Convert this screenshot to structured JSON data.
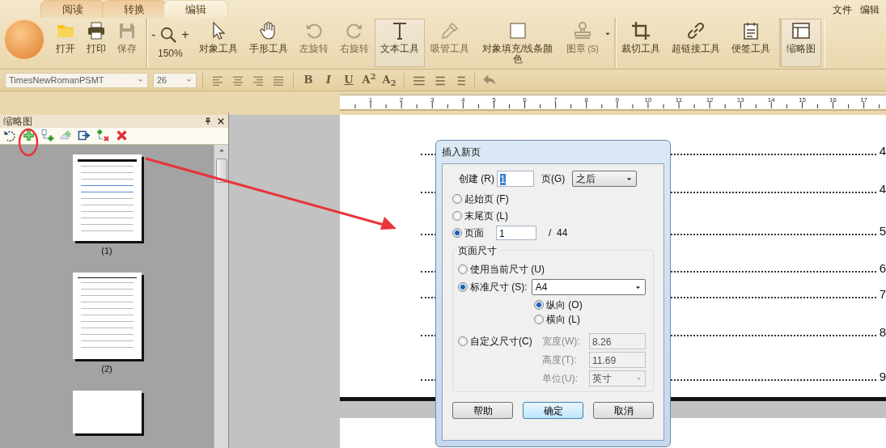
{
  "tabs": [
    {
      "label": "阅读",
      "selected": false
    },
    {
      "label": "转换",
      "selected": false
    },
    {
      "label": "编辑",
      "selected": true
    }
  ],
  "menu": [
    "文件",
    "编辑"
  ],
  "toolbar": {
    "groups": [
      {
        "items": [
          {
            "kind": "button",
            "label": "打开",
            "disabled": false,
            "pressed": false
          },
          {
            "kind": "button",
            "label": "打印",
            "disabled": false,
            "pressed": false
          },
          {
            "kind": "button",
            "label": "保存",
            "disabled": true,
            "pressed": false
          }
        ]
      },
      {
        "items": [
          {
            "kind": "zoom",
            "minus": "-",
            "plus": "+",
            "label": "150%"
          },
          {
            "kind": "button",
            "label": "对象工具",
            "disabled": false,
            "pressed": false
          },
          {
            "kind": "button",
            "label": "手形工具",
            "disabled": false,
            "pressed": false
          },
          {
            "kind": "button",
            "label": "左旋转",
            "disabled": true,
            "pressed": false
          },
          {
            "kind": "button",
            "label": "右旋转",
            "disabled": true,
            "pressed": false
          },
          {
            "kind": "button",
            "label": "文本工具",
            "disabled": false,
            "pressed": true
          },
          {
            "kind": "button",
            "label": "吸管工具",
            "disabled": true,
            "pressed": false
          },
          {
            "kind": "button",
            "label": "对象填充/线条颜色",
            "disabled": false,
            "pressed": false
          },
          {
            "kind": "dropdown",
            "label": "图章",
            "hint": "(S)",
            "disabled": true,
            "pressed": false
          }
        ]
      },
      {
        "items": [
          {
            "kind": "button",
            "label": "裁切工具",
            "disabled": false,
            "pressed": false
          },
          {
            "kind": "button",
            "label": "超链接工具",
            "disabled": false,
            "pressed": false
          },
          {
            "kind": "button",
            "label": "便签工具",
            "disabled": false,
            "pressed": false
          }
        ]
      },
      {
        "items": [
          {
            "kind": "button",
            "label": "缩略图",
            "disabled": false,
            "pressed": true
          }
        ]
      }
    ]
  },
  "format_bar": {
    "font": "TimesNewRomanPSMT",
    "size": "26",
    "styles": [
      "B",
      "I",
      "U",
      "A$^{2}$",
      "A$_{2}$"
    ]
  },
  "ruler": {
    "labels": [
      "1",
      "2",
      "3",
      "4",
      "5",
      "6",
      "7",
      "8",
      "9",
      "10",
      "11",
      "12",
      "13",
      "14",
      "15",
      "16",
      "17"
    ]
  },
  "thumbnail_panel": {
    "title": "缩略图",
    "thumbnails": [
      {
        "label": "(1)",
        "partial": false
      },
      {
        "label": "(2)",
        "partial": false
      },
      {
        "partial": true
      }
    ]
  },
  "page": {
    "toc_numbers": [
      "4",
      "4",
      "5",
      "6",
      "7",
      "8",
      "9"
    ]
  },
  "dialog": {
    "title": "插入新页",
    "create_label": "创建 (R)",
    "create_value": "1",
    "create_value_selected": true,
    "page_label": "页(G)",
    "position": "之后",
    "where": [
      {
        "label": "起始页 (F)",
        "selected": false
      },
      {
        "label": "末尾页 (L)",
        "selected": false
      },
      {
        "label": "页面",
        "selected": true,
        "value": "1",
        "total": "/  44"
      }
    ],
    "size_group": "页面尺寸",
    "size": [
      {
        "label": "使用当前尺寸 (U)",
        "selected": false
      },
      {
        "label": "标准尺寸 (S):",
        "selected": true,
        "value": "A4"
      },
      {
        "label": "自定义尺寸(C)",
        "selected": false
      }
    ],
    "orientation": [
      {
        "label": "纵向 (O)",
        "selected": true
      },
      {
        "label": "横向 (L)",
        "selected": false
      }
    ],
    "custom": [
      {
        "label": "宽度(W):",
        "value": "8.26",
        "disabled": true,
        "kind": "field"
      },
      {
        "label": "高度(T):",
        "value": "11.69",
        "disabled": true,
        "kind": "field"
      },
      {
        "label": "单位(U):",
        "value": "英寸",
        "disabled": true,
        "kind": "select"
      }
    ],
    "buttons": [
      {
        "label": "帮助",
        "default": false
      },
      {
        "label": "确定",
        "default": true
      },
      {
        "label": "取消",
        "default": false
      }
    ]
  }
}
